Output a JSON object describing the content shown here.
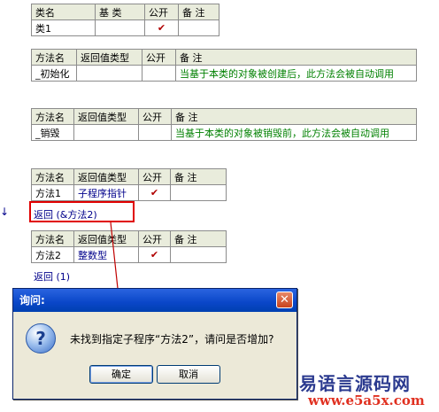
{
  "class_table": {
    "headers": [
      "类名",
      "基 类",
      "公开",
      "备 注"
    ],
    "row": [
      "类1",
      "",
      "✔",
      ""
    ]
  },
  "init_table": {
    "headers": [
      "方法名",
      "返回值类型",
      "公开",
      "备 注"
    ],
    "row": [
      "_初始化",
      "",
      "",
      "当基于本类的对象被创建后，此方法会被自动调用"
    ]
  },
  "destroy_table": {
    "headers": [
      "方法名",
      "返回值类型",
      "公开",
      "备 注"
    ],
    "row": [
      "_销毁",
      "",
      "",
      "当基于本类的对象被销毁前，此方法会被自动调用"
    ]
  },
  "method1_table": {
    "headers": [
      "方法名",
      "返回值类型",
      "公开",
      "备 注"
    ],
    "row": [
      "方法1",
      "子程序指针",
      "✔",
      ""
    ]
  },
  "return_line_1": "返回 (&方法2)",
  "method2_table": {
    "headers": [
      "方法名",
      "返回值类型",
      "公开",
      "备 注"
    ],
    "row": [
      "方法2",
      "整数型",
      "✔",
      ""
    ]
  },
  "return_line_2": "返回 (1)",
  "dialog": {
    "title": "询问:",
    "close_glyph": "✕",
    "icon_glyph": "?",
    "message": "未找到指定子程序“方法2”，请问是否增加?",
    "ok_label": "确定",
    "cancel_label": "取消"
  },
  "watermark": {
    "line1": "易语言源码网",
    "line2": "www.e5a5x.com"
  },
  "colors": {
    "header_bg": "#e9ecdc",
    "note_text": "#008000",
    "highlight_box": "#e00000",
    "dialog_titlebar": "#0a46c8"
  }
}
